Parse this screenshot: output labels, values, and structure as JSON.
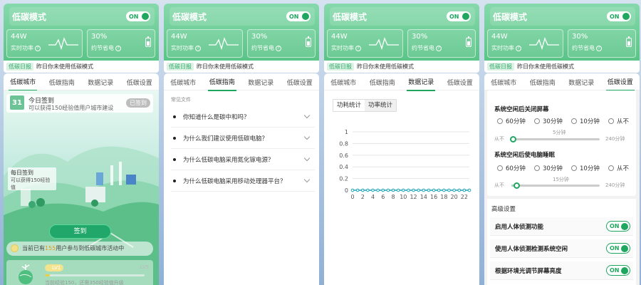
{
  "header": {
    "mode_title": "低碳模式",
    "toggle_label": "ON",
    "power_value": "44W",
    "power_label": "实时功率",
    "saving_value": "30%",
    "saving_label": "约节省电",
    "report_tag": "低碳日报",
    "report_text": "昨日你未使用低碳模式"
  },
  "tabs": [
    "低碳城市",
    "低碳指南",
    "数据记录",
    "低碳设置"
  ],
  "city": {
    "sign_title": "今日签到",
    "sign_sub": "可以获得150经验值用户城市建设",
    "signed_label": "已签到",
    "calendar_day": "31",
    "daily_title": "每日签到",
    "daily_sub": "可以获得150经验值",
    "sign_button": "签到",
    "participants_prefix": "当前已有",
    "participants_count": "155",
    "participants_suffix": "用户参与到低碳城市活动中",
    "level_current": "LV1",
    "level_max": "LV5",
    "level_progress": 0.05,
    "level_text": "当前经验150，还需350经验值升级"
  },
  "guide": {
    "section_title": "常见文件",
    "items": [
      "你知道什么是碳中和吗？",
      "为什么我们建议使用低碳电脑？",
      "为什么低碳电脑采用氮化镓电源？",
      "为什么低碳电脑采用移动处理器平台？"
    ]
  },
  "data_record": {
    "subtabs": [
      "功耗统计",
      "功率统计"
    ],
    "chart_data": {
      "type": "line",
      "x": [
        0,
        1,
        2,
        3,
        4,
        5,
        6,
        7,
        8,
        9,
        10,
        11,
        12,
        13,
        14,
        15,
        16,
        17,
        18,
        19,
        20,
        21,
        22,
        23
      ],
      "values": [
        0,
        0,
        0,
        0,
        0,
        0,
        0,
        0,
        0,
        0,
        0,
        0,
        0,
        0,
        0,
        0,
        0,
        0,
        0,
        0,
        0,
        0,
        0,
        0
      ],
      "x_ticks": [
        "0",
        "2",
        "4",
        "6",
        "8",
        "10",
        "12",
        "14",
        "16",
        "18",
        "20",
        "22"
      ],
      "y_ticks": [
        "0",
        "0.2",
        "0.4",
        "0.6",
        "0.8",
        "1"
      ],
      "ylim": [
        0,
        1
      ],
      "color": "#1aa6b7",
      "grid": true
    }
  },
  "settings": {
    "screen_off_title": "系统空闲后关闭屏幕",
    "sleep_title": "系统空闲后使电脑睡眠",
    "options": [
      "60分钟",
      "30分钟",
      "10分钟",
      "从不"
    ],
    "slider_min": "从不",
    "slider_max": "240分钟",
    "screen_off_value": "5分钟",
    "screen_off_fraction": 0.02,
    "sleep_value": "15分钟",
    "sleep_fraction": 0.06,
    "advanced_title": "高级设置",
    "advanced_items": [
      {
        "label": "启用人体侦测功能",
        "toggle": "ON"
      },
      {
        "label": "使用人体侦测检测系统空闲",
        "toggle": "ON"
      },
      {
        "label": "根据环境光调节屏幕亮度",
        "toggle": "ON"
      }
    ]
  },
  "colors": {
    "accent": "#1fa760",
    "header_top": "#86d9ac",
    "header_bottom": "#56c283",
    "chart_line": "#1aa6b7"
  }
}
